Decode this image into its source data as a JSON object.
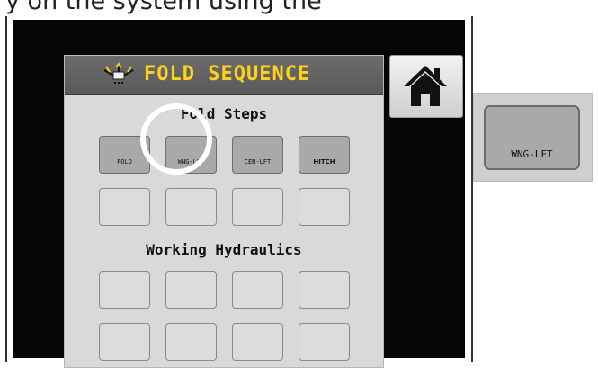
{
  "caption": "y on the system using the",
  "header": {
    "title": "FOLD SEQUENCE",
    "icon": "fold-implement-icon"
  },
  "fold_steps": {
    "title": "Fold Steps",
    "buttons": [
      "FOLD",
      "WNG-LFT",
      "CEN-LFT",
      "HITCH"
    ]
  },
  "working_hydraulics": {
    "title": "Working Hydraulics"
  },
  "home_button": {
    "icon": "home-icon"
  },
  "callout": {
    "label": "WNG-LFT"
  },
  "colors": {
    "title_yellow": "#ffd21a",
    "highlight_ring": "#ffffff"
  }
}
